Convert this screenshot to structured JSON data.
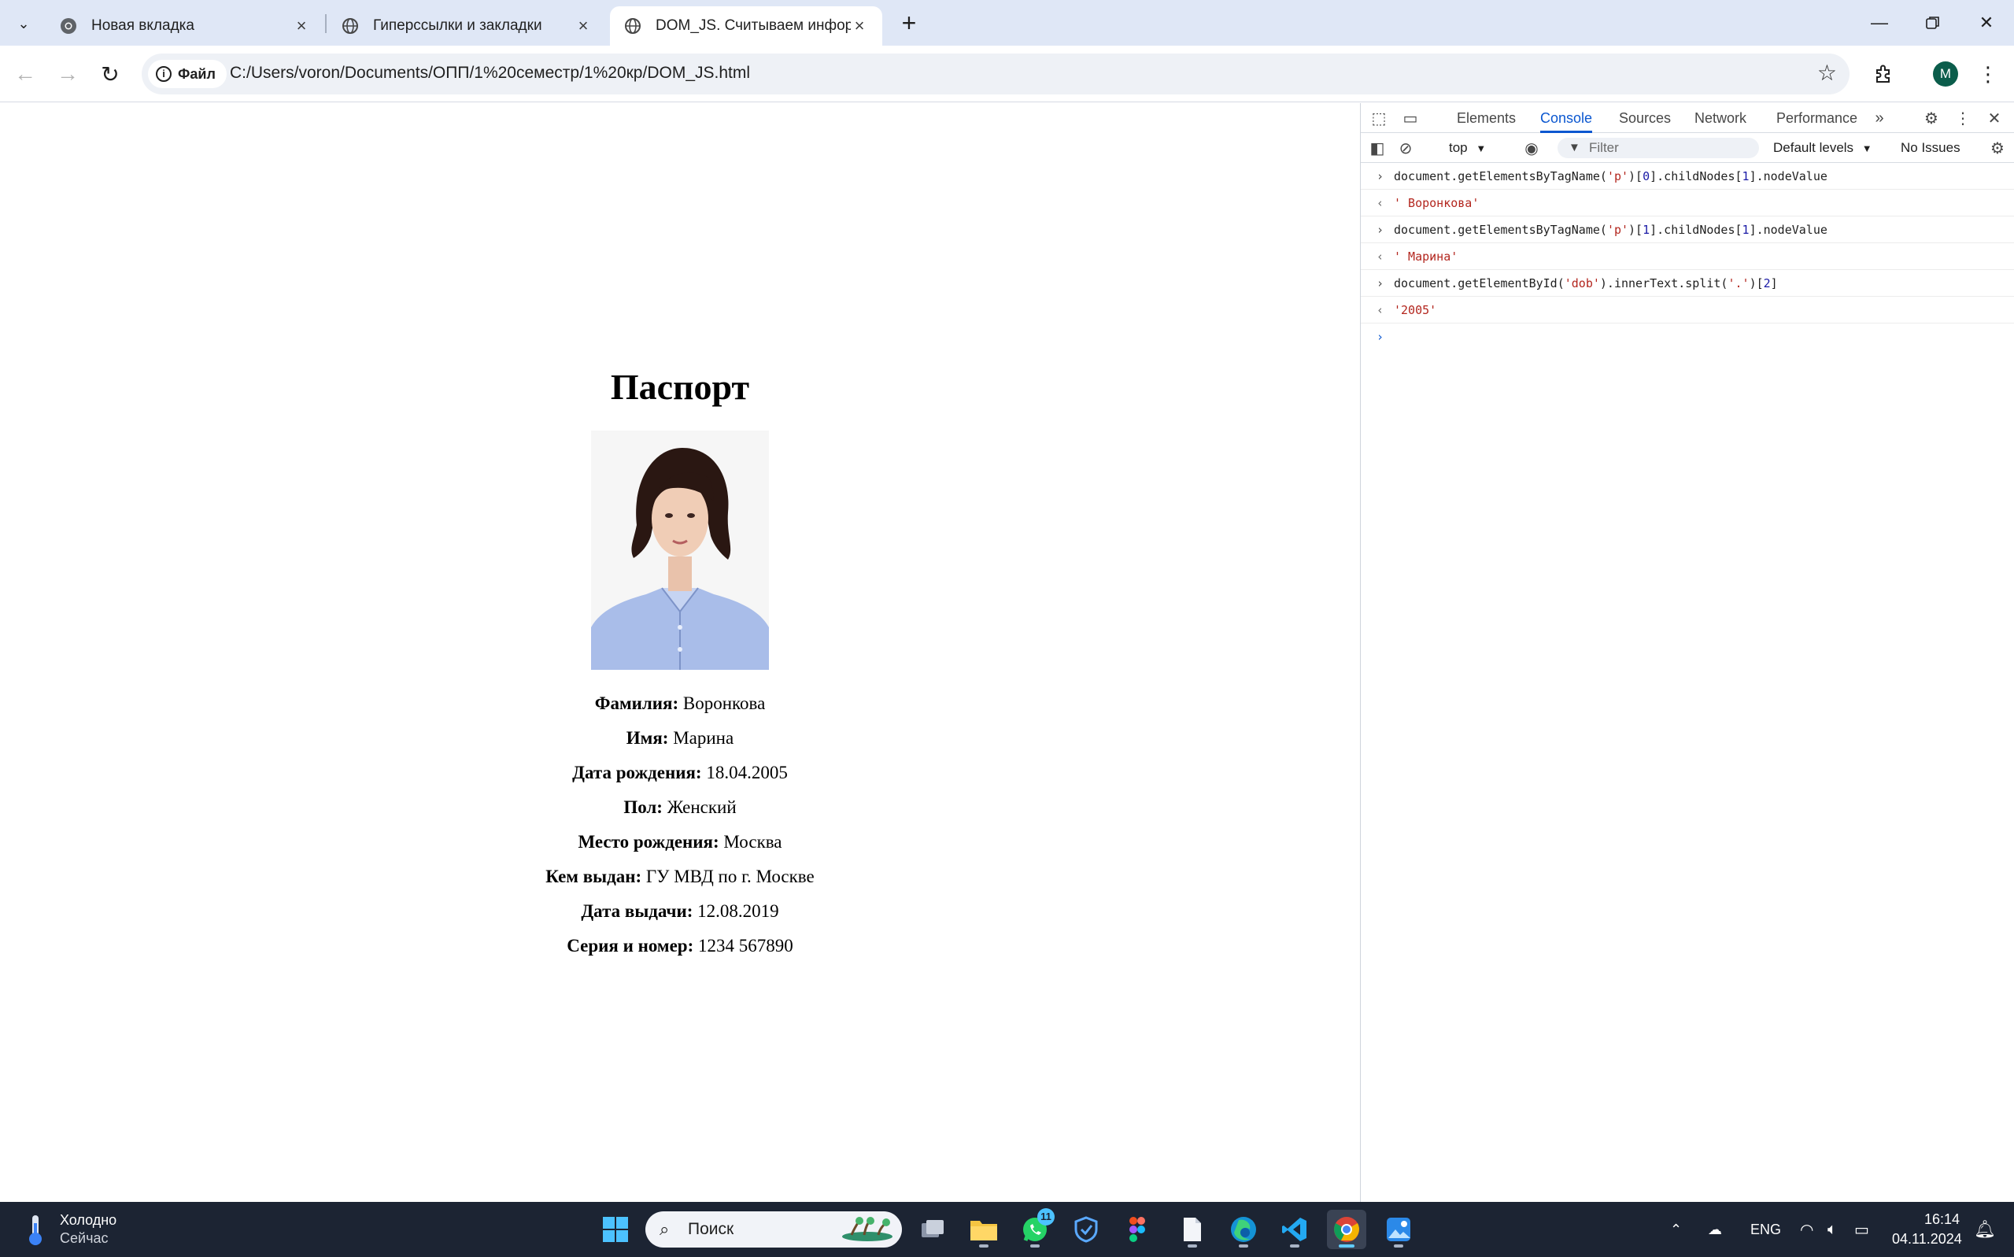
{
  "browser": {
    "tabs": [
      {
        "title": "Новая вкладка",
        "active": false
      },
      {
        "title": "Гиперссылки и закладки",
        "active": false
      },
      {
        "title": "DOM_JS. Считываем информа",
        "active": true
      }
    ],
    "site_chip": "Файл",
    "url": "C:/Users/voron/Documents/ОПП/1%20семестр/1%20кр/DOM_JS.html",
    "profile_initial": "M"
  },
  "passport": {
    "heading": "Паспорт",
    "fields": [
      {
        "label": "Фамилия:",
        "value": "Воронкова"
      },
      {
        "label": "Имя:",
        "value": "Марина"
      },
      {
        "label": "Дата рождения:",
        "value": "18.04.2005"
      },
      {
        "label": "Пол:",
        "value": "Женский"
      },
      {
        "label": "Место рождения:",
        "value": "Москва"
      },
      {
        "label": "Кем выдан:",
        "value": "ГУ МВД по г. Москве"
      },
      {
        "label": "Дата выдачи:",
        "value": "12.08.2019"
      },
      {
        "label": "Серия и номер:",
        "value": "1234 567890"
      }
    ]
  },
  "devtools": {
    "tabs": [
      "Elements",
      "Console",
      "Sources",
      "Network",
      "Performance"
    ],
    "active_tab": "Console",
    "context": "top",
    "filter_placeholder": "Filter",
    "levels": "Default levels",
    "issues": "No Issues",
    "console": [
      {
        "type": "input",
        "pre": "document.getElementsByTagName(",
        "s1": "'p'",
        "mid1": ")[",
        "n1": "0",
        "mid2": "].childNodes[",
        "n2": "1",
        "post": "].nodeValue"
      },
      {
        "type": "output",
        "text": "' Воронкова'"
      },
      {
        "type": "input",
        "pre": "document.getElementsByTagName(",
        "s1": "'p'",
        "mid1": ")[",
        "n1": "1",
        "mid2": "].childNodes[",
        "n2": "1",
        "post": "].nodeValue"
      },
      {
        "type": "output",
        "text": "' Марина'"
      },
      {
        "type": "input3",
        "pre": "document.getElementById(",
        "s1": "'dob'",
        "mid1": ").innerText.split(",
        "s2": "'.'",
        "mid2": ")[",
        "n1": "2",
        "post": "]"
      },
      {
        "type": "output",
        "text": "'2005'"
      }
    ]
  },
  "taskbar": {
    "weather_title": "Холодно",
    "weather_sub": "Сейчас",
    "search_label": "Поиск",
    "whatsapp_badge": "11",
    "lang": "ENG",
    "time": "16:14",
    "date": "04.11.2024"
  },
  "colors": {
    "accent": "#0b57d0",
    "tabstrip": "#dfe7f6",
    "taskbar": "#1c2433",
    "console_string": "#b3261e",
    "console_number": "#1a1aa6"
  }
}
